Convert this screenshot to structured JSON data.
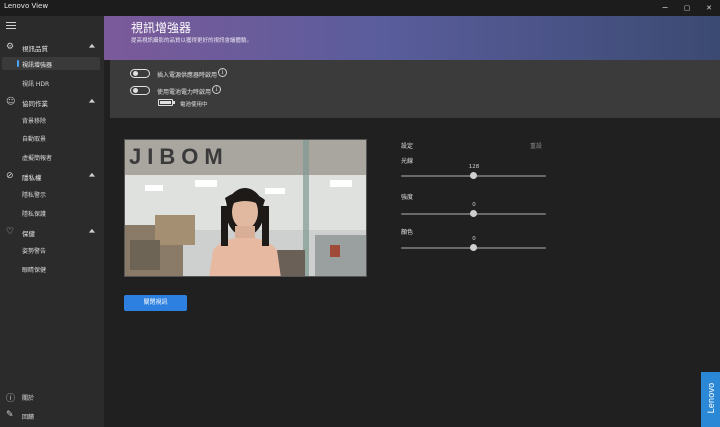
{
  "window": {
    "title": "Lenovo View",
    "minimize": "−",
    "maximize": "▢",
    "close": "✕"
  },
  "sidebar": {
    "sections": [
      {
        "label": "視訊品質",
        "icon": "camera-settings-icon",
        "items": [
          {
            "label": "視訊增強器",
            "active": true
          },
          {
            "label": "視訊 HDR",
            "active": false
          }
        ]
      },
      {
        "label": "協同作業",
        "icon": "collaboration-icon",
        "items": [
          {
            "label": "背景移除"
          },
          {
            "label": "自動取景"
          },
          {
            "label": "虛擬簡報者"
          }
        ]
      },
      {
        "label": "隱私權",
        "icon": "privacy-icon",
        "items": [
          {
            "label": "隱私警示"
          },
          {
            "label": "隱私保護"
          }
        ]
      },
      {
        "label": "保健",
        "icon": "wellness-icon",
        "items": [
          {
            "label": "姿勢警告"
          },
          {
            "label": "眼睛保健"
          }
        ]
      }
    ],
    "bottom": [
      {
        "label": "關於",
        "icon": "info-icon"
      },
      {
        "label": "回饋",
        "icon": "feedback-icon"
      }
    ]
  },
  "header": {
    "title": "視訊增強器",
    "subtitle": "提高視訊攝影的品質以獲得更好的視訊會議體驗。"
  },
  "options": {
    "toggle_1": "插入電源供應器時啟用",
    "toggle_2": "使用電池電力時啟用",
    "battery_status": "電池使用中"
  },
  "preview": {
    "sign_text": "JIBOM",
    "close_button": "關閉視訊"
  },
  "settings": {
    "title": "設定",
    "reset": "重設",
    "sliders": [
      {
        "label": "光線",
        "value": "128",
        "fraction": 0.5
      },
      {
        "label": "強度",
        "value": "0",
        "fraction": 0.5
      },
      {
        "label": "顏色",
        "value": "0",
        "fraction": 0.5
      }
    ]
  },
  "brand": {
    "text": "Lenovo"
  },
  "colors": {
    "accent": "#2d7fe0",
    "banner_start": "#7b5a9a",
    "banner_end": "#3b4a72",
    "brand_blue": "#2a88d6"
  }
}
